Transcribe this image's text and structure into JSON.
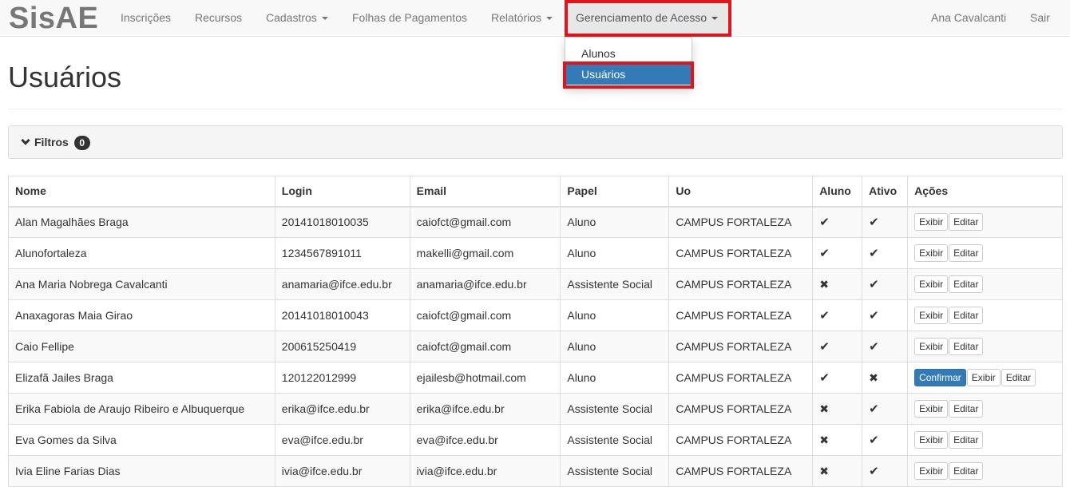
{
  "navbar": {
    "brand": "SisAE",
    "items": [
      {
        "label": "Inscrições",
        "dropdown": false
      },
      {
        "label": "Recursos",
        "dropdown": false
      },
      {
        "label": "Cadastros",
        "dropdown": true
      },
      {
        "label": "Folhas de Pagamentos",
        "dropdown": false
      },
      {
        "label": "Relatórios",
        "dropdown": true
      },
      {
        "label": "Gerenciamento de Acesso",
        "dropdown": true,
        "open": true
      }
    ],
    "user": "Ana Cavalcanti",
    "logout": "Sair"
  },
  "dropdown": {
    "items": [
      {
        "label": "Alunos",
        "active": false
      },
      {
        "label": "Usuários",
        "active": true
      }
    ]
  },
  "page": {
    "title": "Usuários"
  },
  "filters": {
    "label": "Filtros",
    "count": "0"
  },
  "table": {
    "headers": [
      "Nome",
      "Login",
      "Email",
      "Papel",
      "Uo",
      "Aluno",
      "Ativo",
      "Ações"
    ],
    "rows": [
      {
        "nome": "Alan Magalhães Braga",
        "login": "20141018010035",
        "email": "caiofct@gmail.com",
        "papel": "Aluno",
        "uo": "CAMPUS FORTALEZA",
        "aluno": true,
        "ativo": true,
        "confirmar": false
      },
      {
        "nome": "Alunofortaleza",
        "login": "1234567891011",
        "email": "makelli@gmail.com",
        "papel": "Aluno",
        "uo": "CAMPUS FORTALEZA",
        "aluno": true,
        "ativo": true,
        "confirmar": false
      },
      {
        "nome": "Ana Maria Nobrega Cavalcanti",
        "login": "anamaria@ifce.edu.br",
        "email": "anamaria@ifce.edu.br",
        "papel": "Assistente Social",
        "uo": "CAMPUS FORTALEZA",
        "aluno": false,
        "ativo": true,
        "confirmar": false
      },
      {
        "nome": "Anaxagoras Maia Girao",
        "login": "20141018010043",
        "email": "caiofct@gmail.com",
        "papel": "Aluno",
        "uo": "CAMPUS FORTALEZA",
        "aluno": true,
        "ativo": true,
        "confirmar": false
      },
      {
        "nome": "Caio Fellipe",
        "login": "200615250419",
        "email": "caiofct@gmail.com",
        "papel": "Aluno",
        "uo": "CAMPUS FORTALEZA",
        "aluno": true,
        "ativo": true,
        "confirmar": false
      },
      {
        "nome": "Elizafã Jailes Braga",
        "login": "120122012999",
        "email": "ejailesb@hotmail.com",
        "papel": "Aluno",
        "uo": "CAMPUS FORTALEZA",
        "aluno": true,
        "ativo": false,
        "confirmar": true
      },
      {
        "nome": "Erika Fabiola de Araujo Ribeiro e Albuquerque",
        "login": "erika@ifce.edu.br",
        "email": "erika@ifce.edu.br",
        "papel": "Assistente Social",
        "uo": "CAMPUS FORTALEZA",
        "aluno": false,
        "ativo": true,
        "confirmar": false
      },
      {
        "nome": "Eva Gomes da Silva",
        "login": "eva@ifce.edu.br",
        "email": "eva@ifce.edu.br",
        "papel": "Assistente Social",
        "uo": "CAMPUS FORTALEZA",
        "aluno": false,
        "ativo": true,
        "confirmar": false
      },
      {
        "nome": "Ivia Eline Farias Dias",
        "login": "ivia@ifce.edu.br",
        "email": "ivia@ifce.edu.br",
        "papel": "Assistente Social",
        "uo": "CAMPUS FORTALEZA",
        "aluno": false,
        "ativo": true,
        "confirmar": false
      }
    ],
    "actions": {
      "confirmar": "Confirmar",
      "exibir": "Exibir",
      "editar": "Editar"
    }
  },
  "colors": {
    "primary": "#337ab7",
    "highlight": "#e0141c"
  }
}
